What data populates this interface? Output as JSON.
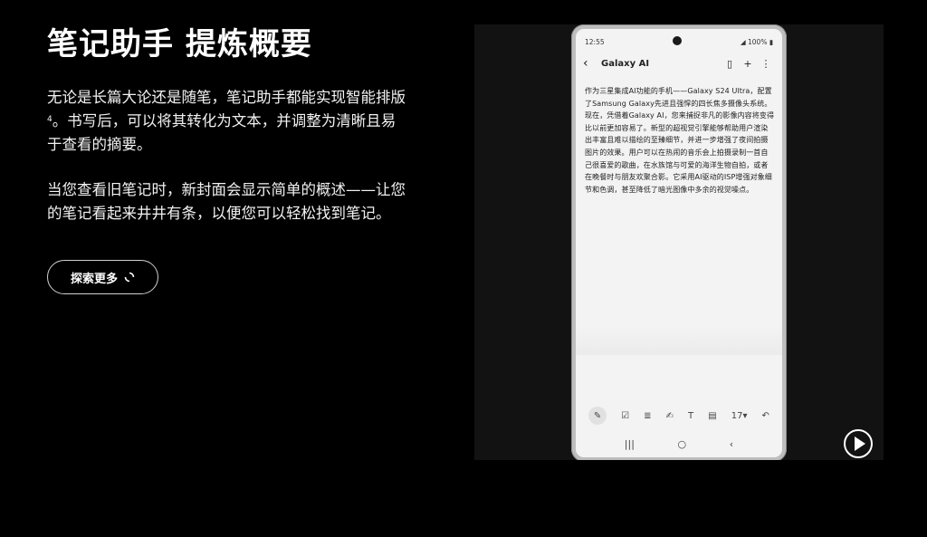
{
  "section": {
    "heading": "笔记助手 提炼概要",
    "para1_text": "无论是长篇大论还是随笔，笔记助手都能实现智能排版",
    "para1_sup": "4",
    "para1_rest": "。书写后，可以将其转化为文本，并调整为清晰且易于查看的摘要。",
    "para2": "当您查看旧笔记时，新封面会显示简单的概述——让您的笔记看起来井井有条，以便您可以轻松找到笔记。",
    "explore_label": "探索更多"
  },
  "video": {
    "icons": {
      "play": "play-icon",
      "explore": "loading-spinner-icon"
    },
    "phone": {
      "time": "12:55",
      "battery": "100%",
      "app_title": "Galaxy AI",
      "toolbar_size": "17",
      "note_text": "作为三星集成AI功能的手机——Galaxy S24 Ultra，配置了Samsung Galaxy先进且强悍的四长焦多摄像头系统。现在，凭借着Galaxy AI，您来捕捉非凡的影像内容将变得比以前更加容易了。新型的超视觉引擎能够帮助用户渲染出丰富且难以描绘的至臻细节，并进一步增强了夜间拍摄图片的效果。用户可以在热闹的音乐会上拍摄录制一首自己很喜爱的歌曲，在水族馆与可爱的海洋生物自拍，或者在晚餐时与朋友欢聚合影。它采用AI驱动的ISP增强对象细节和色调，甚至降低了暗光图像中多余的视觉噪点。"
    }
  }
}
